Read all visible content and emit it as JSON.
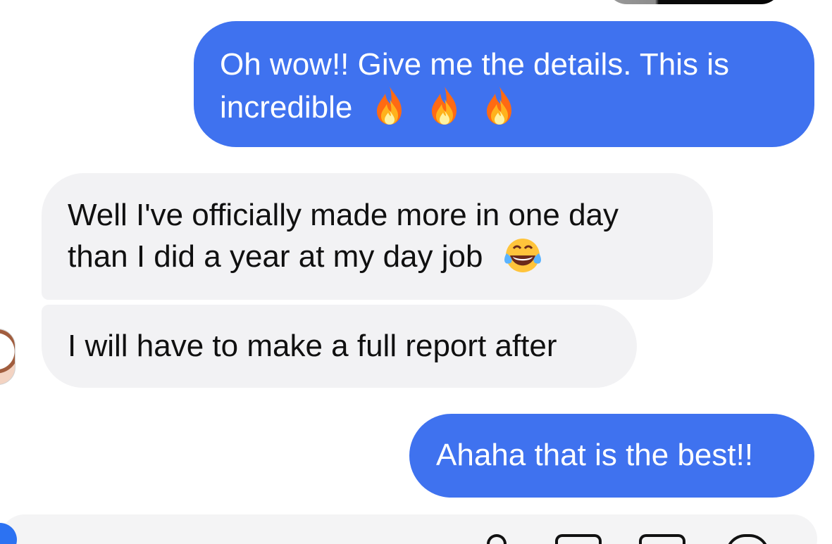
{
  "conversation": {
    "messages": [
      {
        "direction": "outgoing",
        "lines": [
          "Oh wow!! Give me the details. This is",
          "incredible"
        ],
        "emoji": [
          "fire",
          "fire",
          "fire"
        ]
      },
      {
        "direction": "incoming",
        "lines": [
          "Well I've officially made more in one day",
          "than I did a year at my day job"
        ],
        "emoji": [
          "laugh"
        ]
      },
      {
        "direction": "incoming",
        "lines": [
          "I will have to make a full report after"
        ]
      },
      {
        "direction": "outgoing",
        "lines": [
          "Ahaha that is the best!!"
        ]
      }
    ]
  },
  "colors": {
    "outgoing_bubble": "#3f72ef",
    "incoming_bubble": "#f2f2f4",
    "outgoing_text": "#ffffff",
    "incoming_text": "#101010"
  }
}
